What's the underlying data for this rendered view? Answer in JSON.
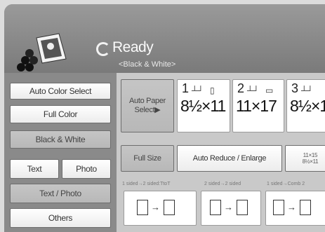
{
  "status": {
    "ready_text": "Ready",
    "mode_text": "<Black & White>"
  },
  "left_buttons": {
    "auto_color_select": "Auto Color Select",
    "full_color": "Full Color",
    "black_white": "Black & White",
    "text": "Text",
    "photo": "Photo",
    "text_photo": "Text / Photo",
    "others": "Others"
  },
  "paper": {
    "auto_paper_select_line1": "Auto Paper",
    "auto_paper_select_line2": "Select▶",
    "trays": [
      {
        "num": "1",
        "size": "8½×11"
      },
      {
        "num": "2",
        "size": "11×17"
      },
      {
        "num": "3",
        "size": "8½×1"
      }
    ]
  },
  "reduce": {
    "full_size": "Full Size",
    "auto_reduce_enlarge": "Auto Reduce / Enlarge",
    "ratio_line1": "11×15",
    "ratio_line2": "8½×11"
  },
  "duplex": {
    "labels": [
      "1 sided→2 sided:TtoT",
      "2 sided→2 sided",
      "1 sided→Comb 2"
    ]
  },
  "icons": {
    "status": "refresh-icon",
    "logo": "copier-logo-icon",
    "tray": "paper-tray-icon"
  }
}
